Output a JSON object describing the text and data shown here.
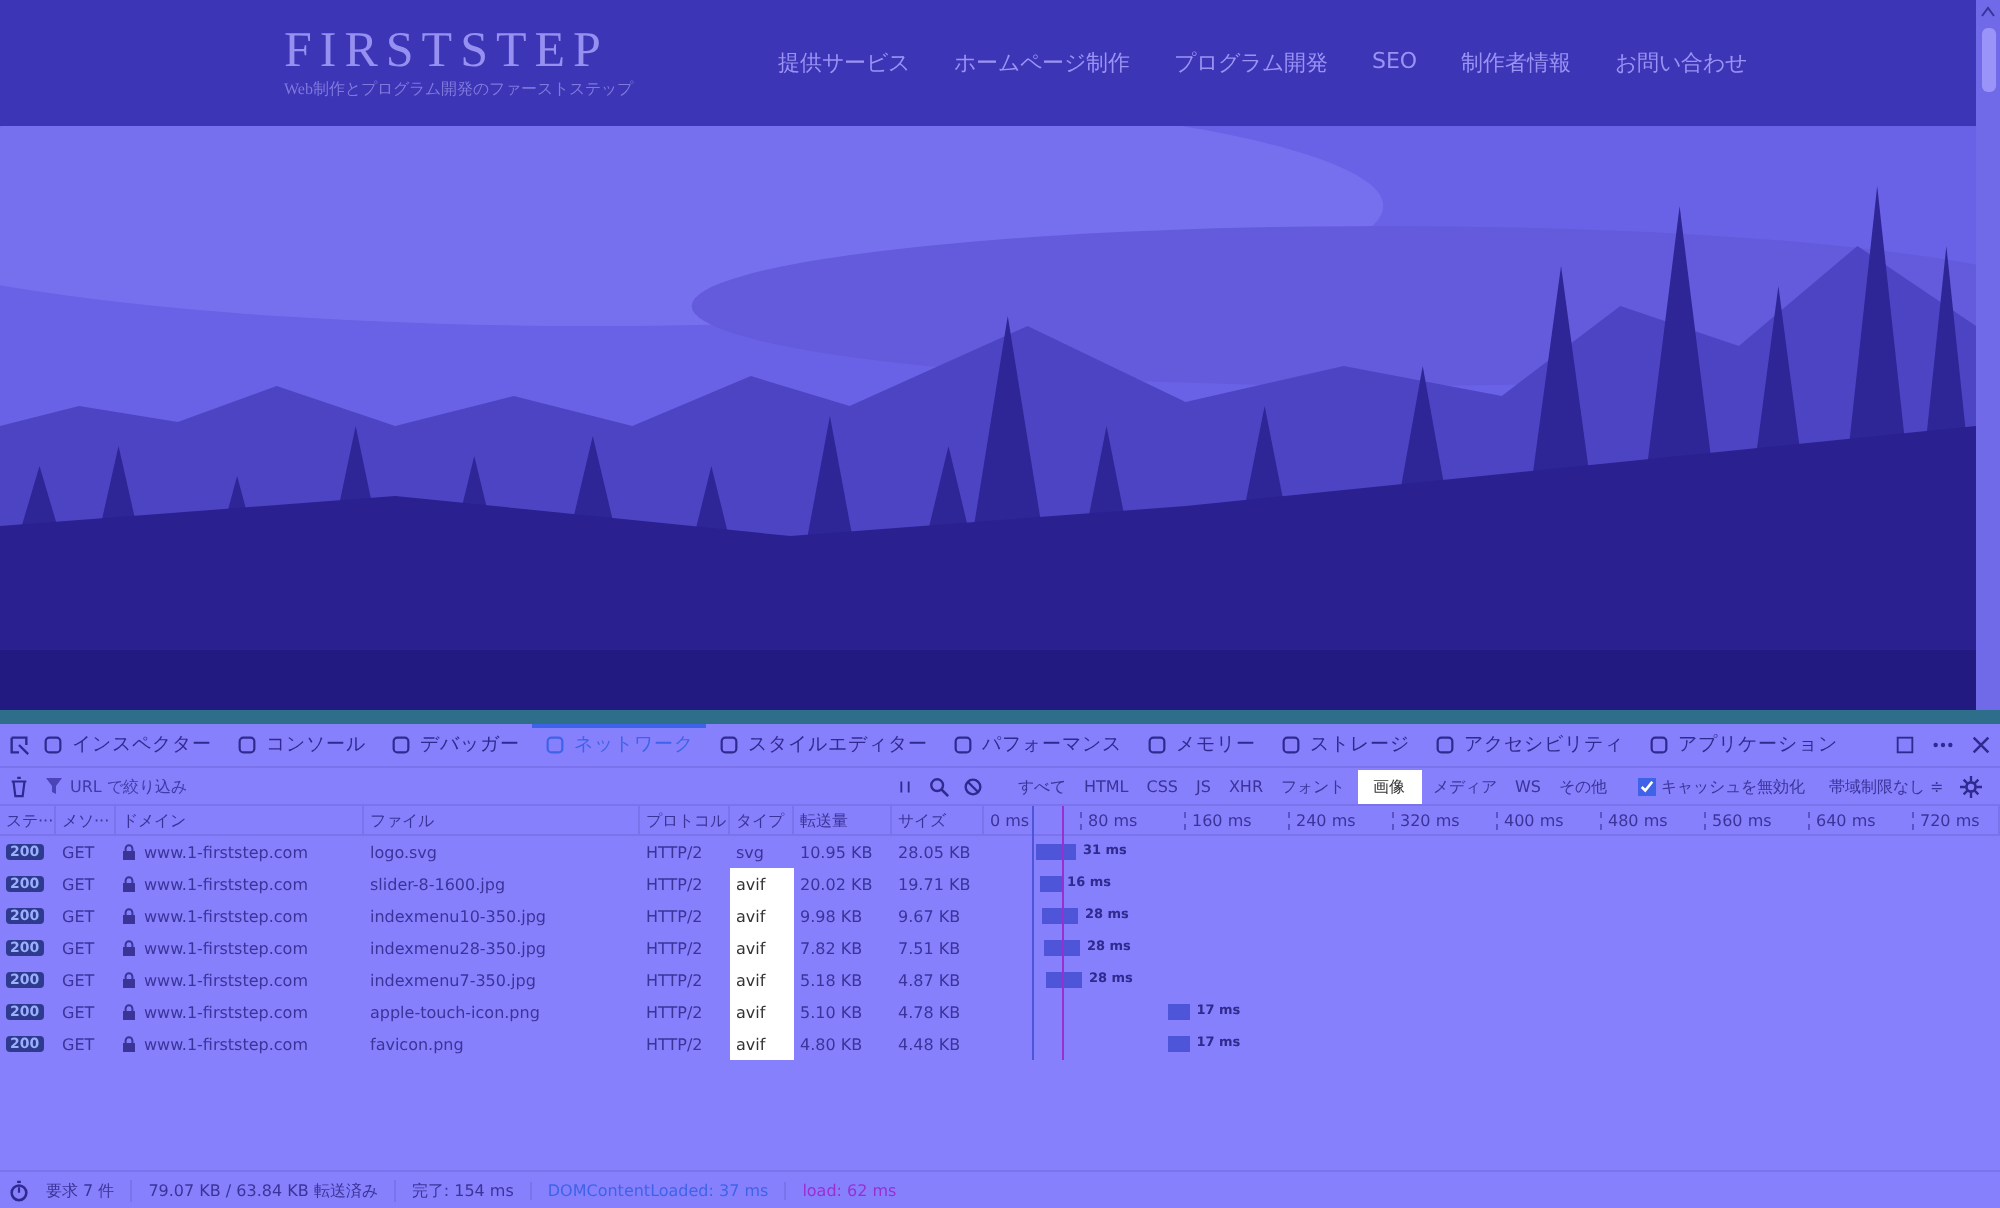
{
  "site": {
    "logo": "FIRSTSTEP",
    "tagline": "Web制作とプログラム開発のファーストステップ",
    "nav": [
      "提供サービス",
      "ホームページ制作",
      "プログラム開発",
      "SEO",
      "制作者情報",
      "お問い合わせ"
    ],
    "hero": {
      "kind": "picture"
    }
  },
  "devtools": {
    "tabs": [
      {
        "label": "インスペクター",
        "selected": false
      },
      {
        "label": "コンソール",
        "selected": false
      },
      {
        "label": "デバッガー",
        "selected": false
      },
      {
        "label": "ネットワーク",
        "selected": true
      },
      {
        "label": "スタイルエディター",
        "selected": false
      },
      {
        "label": "パフォーマンス",
        "selected": false
      },
      {
        "label": "メモリー",
        "selected": false
      },
      {
        "label": "ストレージ",
        "selected": false
      },
      {
        "label": "アクセシビリティ",
        "selected": false
      },
      {
        "label": "アプリケーション",
        "selected": false
      }
    ],
    "filter": {
      "placeholder": "URL で絞り込み"
    },
    "type_filters": [
      {
        "label": "すべて",
        "selected": false
      },
      {
        "label": "HTML",
        "selected": false
      },
      {
        "label": "CSS",
        "selected": false
      },
      {
        "label": "JS",
        "selected": false
      },
      {
        "label": "XHR",
        "selected": false
      },
      {
        "label": "フォント",
        "selected": false
      },
      {
        "label": "画像",
        "selected": true
      },
      {
        "label": "メディア",
        "selected": false
      },
      {
        "label": "WS",
        "selected": false
      },
      {
        "label": "その他",
        "selected": false
      }
    ],
    "disable_cache": {
      "label": "キャッシュを無効化",
      "checked": true
    },
    "throttle": "帯域制限なし ≑",
    "table": {
      "columns": [
        "ステ···",
        "メソ···",
        "ドメイン",
        "ファイル",
        "プロトコル",
        "タイプ",
        "転送量",
        "サイズ"
      ],
      "ticks": [
        "0 ms",
        "80 ms",
        "160 ms",
        "240 ms",
        "320 ms",
        "400 ms",
        "480 ms",
        "560 ms",
        "640 ms",
        "720 ms"
      ],
      "rows": [
        {
          "status": "200",
          "method": "GET",
          "domain": "www.1-firststep.com",
          "file": "logo.svg",
          "protocol": "HTTP/2",
          "type": "svg",
          "transferred": "10.95 KB",
          "size": "28.05 KB",
          "timing": "31 ms",
          "highlighted": false
        },
        {
          "status": "200",
          "method": "GET",
          "domain": "www.1-firststep.com",
          "file": "slider-8-1600.jpg",
          "protocol": "HTTP/2",
          "type": "avif",
          "transferred": "20.02 KB",
          "size": "19.71 KB",
          "timing": "16 ms",
          "highlighted": true
        },
        {
          "status": "200",
          "method": "GET",
          "domain": "www.1-firststep.com",
          "file": "indexmenu10-350.jpg",
          "protocol": "HTTP/2",
          "type": "avif",
          "transferred": "9.98 KB",
          "size": "9.67 KB",
          "timing": "28 ms",
          "highlighted": true
        },
        {
          "status": "200",
          "method": "GET",
          "domain": "www.1-firststep.com",
          "file": "indexmenu28-350.jpg",
          "protocol": "HTTP/2",
          "type": "avif",
          "transferred": "7.82 KB",
          "size": "7.51 KB",
          "timing": "28 ms",
          "highlighted": true
        },
        {
          "status": "200",
          "method": "GET",
          "domain": "www.1-firststep.com",
          "file": "indexmenu7-350.jpg",
          "protocol": "HTTP/2",
          "type": "avif",
          "transferred": "5.18 KB",
          "size": "4.87 KB",
          "timing": "28 ms",
          "highlighted": true
        },
        {
          "status": "200",
          "method": "GET",
          "domain": "www.1-firststep.com",
          "file": "apple-touch-icon.png",
          "protocol": "HTTP/2",
          "type": "avif",
          "transferred": "5.10 KB",
          "size": "4.78 KB",
          "timing": "17 ms",
          "highlighted": true
        },
        {
          "status": "200",
          "method": "GET",
          "domain": "www.1-firststep.com",
          "file": "favicon.png",
          "protocol": "HTTP/2",
          "type": "avif",
          "transferred": "4.80 KB",
          "size": "4.48 KB",
          "timing": "17 ms",
          "highlighted": true
        }
      ]
    },
    "status_bar": {
      "requests": "要求 7 件",
      "transferred": "79.07 KB / 63.84 KB 転送済み",
      "finish": "完了: 154 ms",
      "dom_content_loaded": "DOMContentLoaded: 37 ms",
      "load": "load: 62 ms"
    }
  }
}
